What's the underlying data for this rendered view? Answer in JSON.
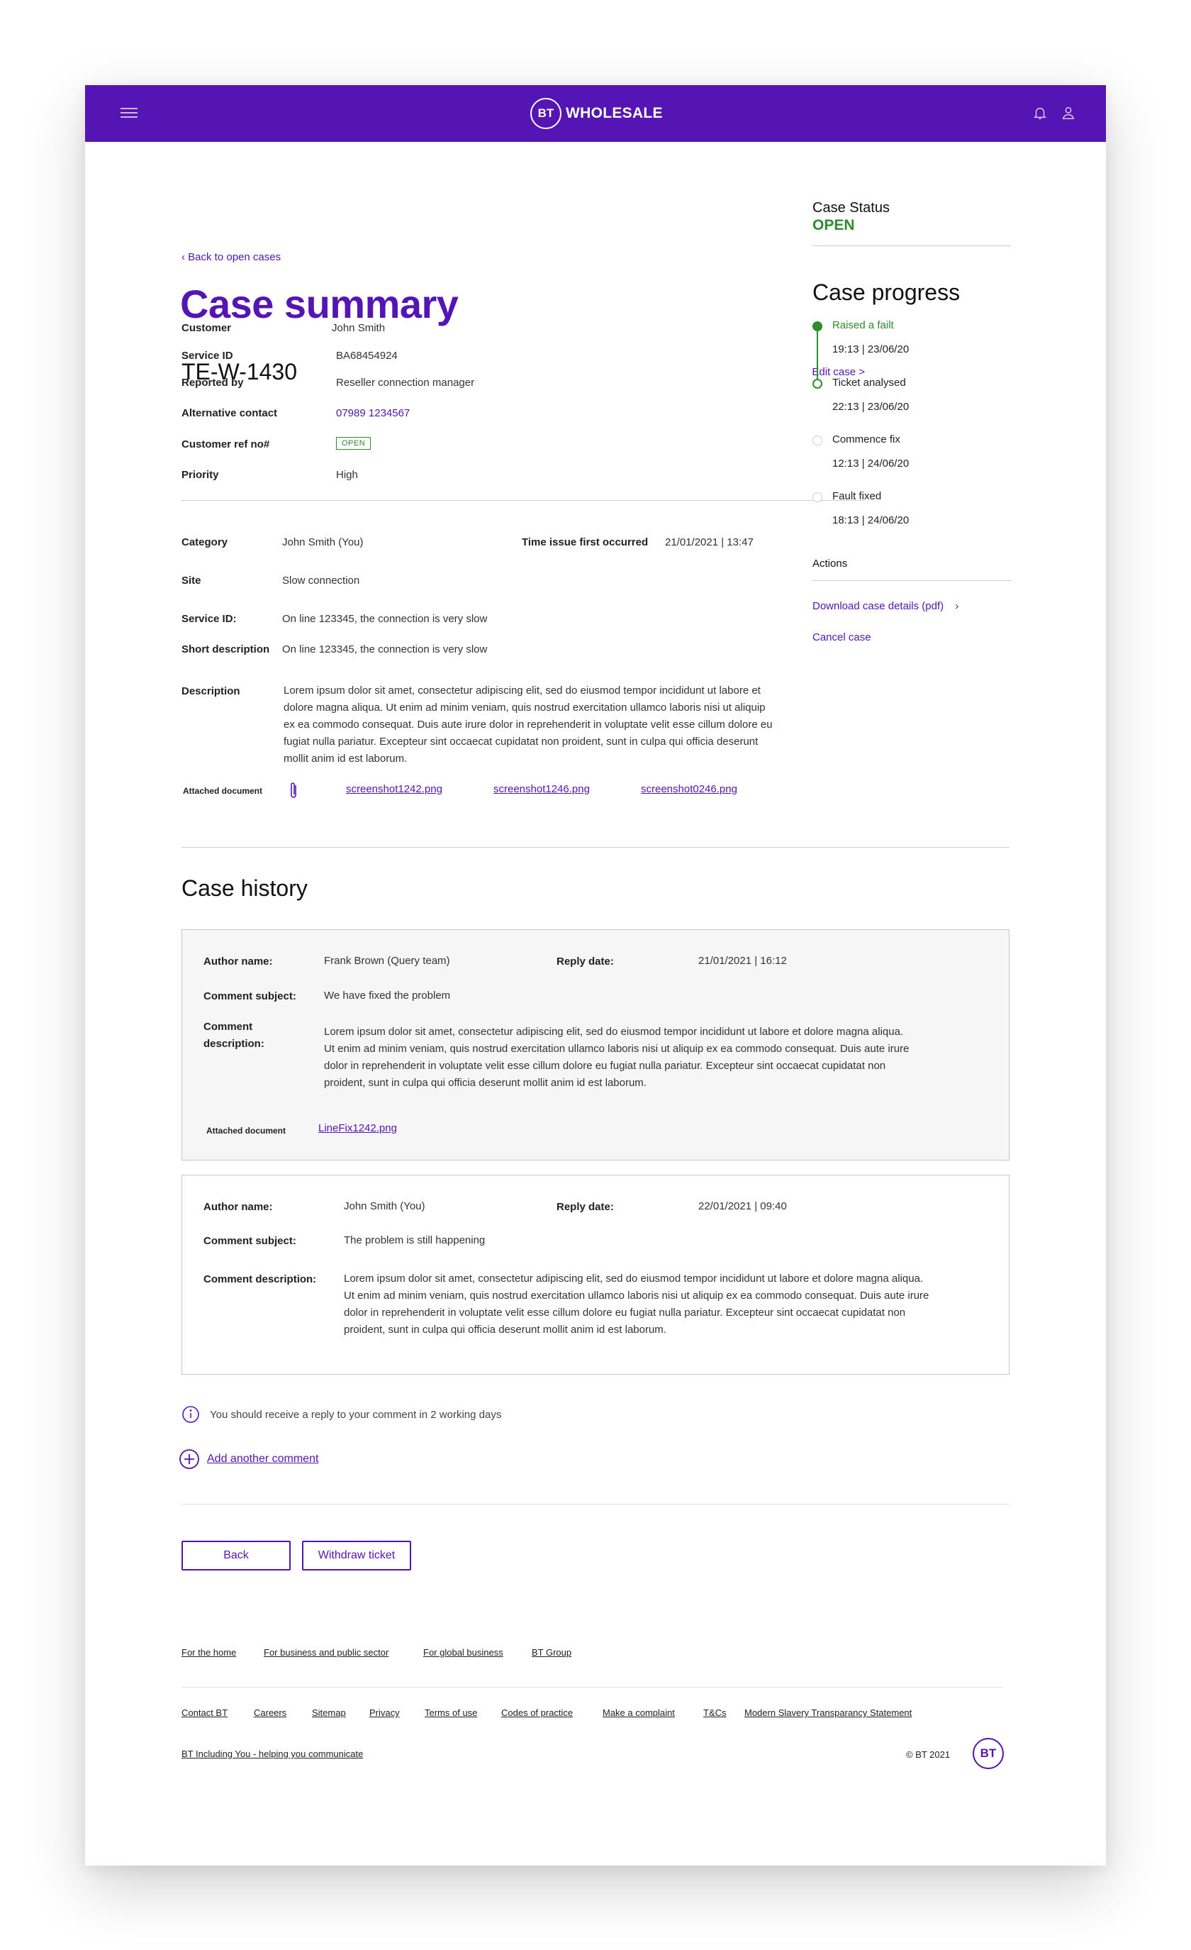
{
  "header": {
    "logo_mark": "BT",
    "logo_text": "WHOLESALE"
  },
  "back_link": "‹  Back to open cases",
  "page_title": "Case summary",
  "case": {
    "id": "TE-W-1430",
    "edit_label": "Edit case >",
    "fields": [
      {
        "label": "Customer",
        "value": "John Smith"
      },
      {
        "label": "Service ID",
        "value": "BA68454924"
      },
      {
        "label": "Reported by",
        "value": "Reseller connection manager"
      },
      {
        "label": "Alternative contact",
        "value": "07989 1234567"
      },
      {
        "label": "Customer ref no#",
        "value": "OPEN"
      },
      {
        "label": "Priority",
        "value": "High"
      }
    ],
    "details": {
      "category_label": "Category",
      "category_value": "John Smith (You)",
      "time_label": "Time issue first occurred",
      "time_value": "21/01/2021 | 13:47",
      "site_label": "Site",
      "site_value": "Slow connection",
      "service_label": "Service ID:",
      "service_value": "On line 123345, the connection is very slow",
      "short_label": "Short description",
      "short_value": "On line 123345, the connection is very slow",
      "description_label": "Description",
      "description_value": "Lorem ipsum dolor sit amet, consectetur adipiscing elit, sed do eiusmod tempor incididunt ut labore et dolore magna aliqua. Ut enim ad minim veniam, quis nostrud exercitation ullamco laboris nisi ut aliquip ex ea commodo consequat. Duis aute irure dolor in reprehenderit in voluptate velit esse cillum dolore eu fugiat nulla pariatur. Excepteur sint occaecat cupidatat non proident, sunt in culpa qui officia deserunt mollit anim id est laborum.",
      "attached_label": "Attached document",
      "attachments": [
        "screenshot1242.png",
        "screenshot1246.png",
        "screenshot0246.png"
      ]
    }
  },
  "sidebar": {
    "status_title": "Case Status",
    "status_value": "OPEN",
    "progress_title": "Case progress",
    "steps": [
      {
        "label": "Raised a failt",
        "time": "19:13 | 23/06/20"
      },
      {
        "label": "Ticket analysed",
        "time": "22:13 | 23/06/20"
      },
      {
        "label": "Commence fix",
        "time": "12:13 | 24/06/20"
      },
      {
        "label": "Fault fixed",
        "time": "18:13 | 24/06/20"
      }
    ],
    "actions_title": "Actions",
    "download_label": "Download case details (pdf)",
    "cancel_label": "Cancel case"
  },
  "history": {
    "title": "Case history",
    "entries": [
      {
        "author_label": "Author name:",
        "author": "Frank Brown (Query team)",
        "reply_label": "Reply date:",
        "reply_date": "21/01/2021 | 16:12",
        "subject_label": "Comment subject:",
        "subject": "We have fixed the problem",
        "desc_label_1": "Comment",
        "desc_label_2": "description:",
        "description": "Lorem ipsum dolor sit amet, consectetur adipiscing elit, sed do eiusmod tempor incididunt ut labore et dolore magna aliqua. Ut enim ad minim veniam, quis nostrud exercitation ullamco laboris nisi ut aliquip ex ea commodo consequat. Duis aute irure dolor in reprehenderit in voluptate velit esse cillum dolore eu fugiat nulla pariatur. Excepteur sint occaecat cupidatat non proident, sunt in culpa qui officia deserunt mollit anim id est laborum.",
        "attached_label": "Attached document",
        "attachment": "LineFix1242.png"
      },
      {
        "author_label": "Author name:",
        "author": "John Smith (You)",
        "reply_label": "Reply date:",
        "reply_date": "22/01/2021 | 09:40",
        "subject_label": "Comment subject:",
        "subject": "The problem is still happening",
        "desc_label": "Comment description:",
        "description": "Lorem ipsum dolor sit amet, consectetur adipiscing elit, sed do eiusmod tempor incididunt ut labore et dolore magna aliqua. Ut enim ad minim veniam, quis nostrud exercitation ullamco laboris nisi ut aliquip ex ea commodo consequat. Duis aute irure dolor in reprehenderit in voluptate velit esse cillum dolore eu fugiat nulla pariatur. Excepteur sint occaecat cupidatat non proident, sunt in culpa qui officia deserunt mollit anim id est laborum."
      }
    ],
    "info_note": "You should receive a reply to your comment in 2 working days",
    "add_comment": "Add another comment"
  },
  "buttons": {
    "back": "Back",
    "withdraw": "Withdraw ticket"
  },
  "footer": {
    "top_links": [
      "For the home",
      "For business and public sector",
      "For global business",
      "BT Group"
    ],
    "links": [
      "Contact BT",
      "Careers",
      "Sitemap",
      "Privacy",
      "Terms of use",
      "Codes of practice",
      "Make a complaint",
      "T&Cs",
      "Modern Slavery Transparancy Statement"
    ],
    "bt_including": "BT Including You - helping you communicate",
    "copyright": "© BT 2021",
    "logo_mark": "BT"
  },
  "colors": {
    "brand": "#5514b4",
    "success": "#2e8b2e"
  }
}
